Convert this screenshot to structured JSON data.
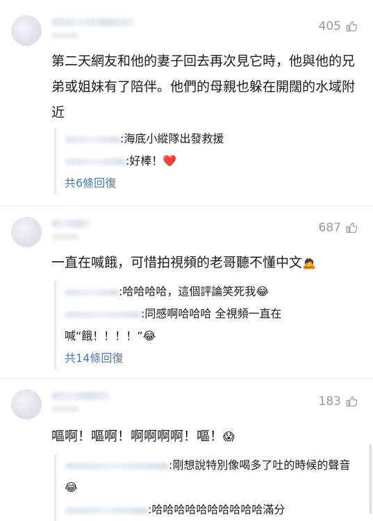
{
  "comments": [
    {
      "likes": "405",
      "text": "第二天網友和他的妻子回去再次見它時，他與他的兄弟或姐妹有了陪伴。他們的母親也躲在開闊的水域附近",
      "replies": [
        {
          "text": ":海底小縱隊出發救援"
        },
        {
          "text": ":好棒！",
          "emoji": "❤️"
        }
      ],
      "more": "共6條回復"
    },
    {
      "likes": "687",
      "text": "一直在喊餓，可惜拍視頻的老哥聽不懂中文",
      "text_emoji": "🙇",
      "replies": [
        {
          "text": ":哈哈哈哈，這個評論笑死我",
          "emoji": "😂"
        },
        {
          "text": ":同感啊哈哈哈 全視頻一直在喊“餓！！！！”",
          "emoji": "😂"
        }
      ],
      "more": "共14條回復"
    },
    {
      "likes": "183",
      "text": "嘔啊！嘔啊！啊啊啊啊！嘔！",
      "text_emoji": "😱",
      "replies": [
        {
          "text": ":剛想說特別像喝多了吐的時候的聲音",
          "emoji": "😂"
        },
        {
          "text": ":哈哈哈哈哈哈哈哈哈哈滿分"
        }
      ]
    }
  ],
  "colors": {
    "link": "#4a7ab5",
    "likes": "#9a9a9a",
    "reply_bar": "#e8e8e8"
  },
  "icons": {
    "like": "thumbs-up-icon"
  }
}
